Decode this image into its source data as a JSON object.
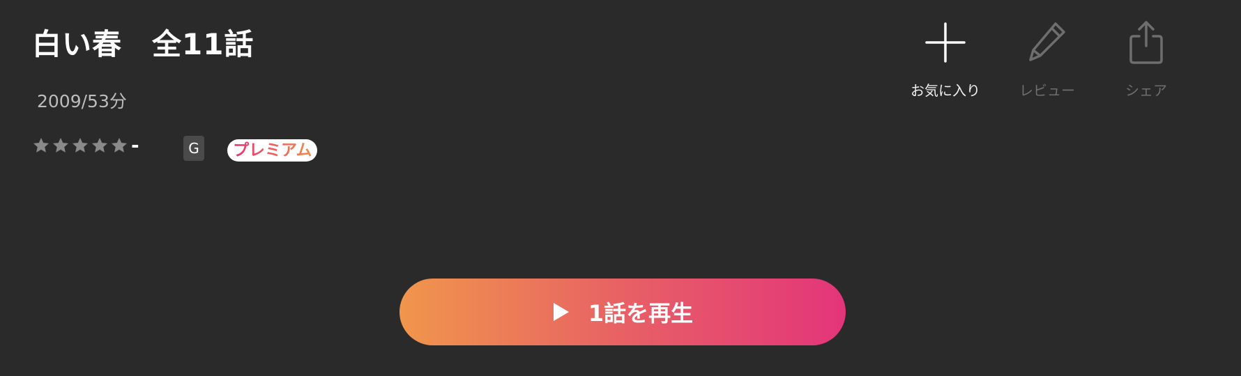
{
  "title": {
    "series_name": "白い春",
    "episodes": "全11話"
  },
  "meta": "2009/53分",
  "rating": {
    "stars_filled": 0,
    "stars_total": 5,
    "value": "-",
    "star_color": "#8a8a8a"
  },
  "age_rating": "G",
  "premium_label": "プレミアム",
  "actions": {
    "favorite": {
      "label": "お気に入り",
      "icon": "plus-icon"
    },
    "review": {
      "label": "レビュー",
      "icon": "pencil-icon"
    },
    "share": {
      "label": "シェア",
      "icon": "share-icon"
    }
  },
  "play_button": {
    "label": "1話を再生",
    "icon": "play-icon",
    "gradient_start": "#f0964c",
    "gradient_end": "#e3357a"
  },
  "colors": {
    "background": "#2a2a2a",
    "text_primary": "#ffffff",
    "text_secondary": "#bdbdbd",
    "text_disabled": "#6e6e6e"
  }
}
